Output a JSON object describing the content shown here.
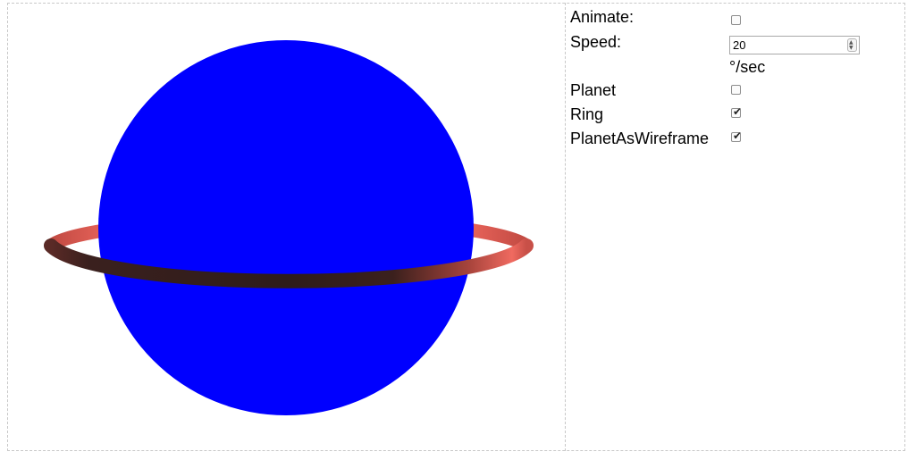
{
  "scene": {
    "planet_color": "#0000ff",
    "ring_color": "#e05a50"
  },
  "controls": {
    "animate": {
      "label": "Animate:",
      "checked": false
    },
    "speed": {
      "label": "Speed:",
      "value": "20",
      "unit": "°/sec"
    },
    "planet": {
      "label": "Planet",
      "checked": false
    },
    "ring": {
      "label": "Ring",
      "checked": true
    },
    "wireframe": {
      "label": "PlanetAsWireframe",
      "checked": true
    }
  }
}
